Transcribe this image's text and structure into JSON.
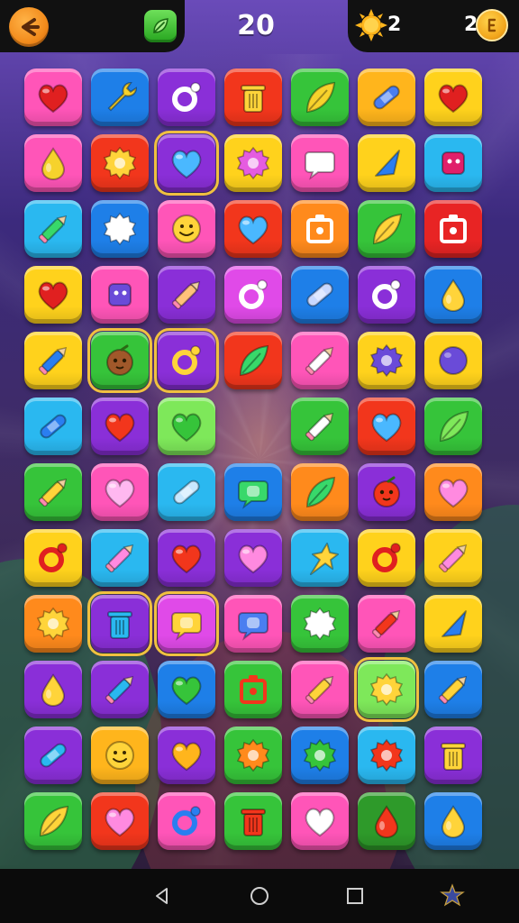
{
  "hud": {
    "moves": "20",
    "sun_count": "2",
    "coin_count": "2",
    "colors": {
      "gold": "#f2a61c",
      "booster": "#26a51f"
    }
  },
  "board": {
    "rows": 12,
    "cols": 7,
    "tiles": [
      [
        {
          "c": "#ff55b8",
          "i": "heart",
          "ic": "#e02020"
        },
        {
          "c": "#1e7fe8",
          "i": "wrench",
          "ic": "#f6d22c"
        },
        {
          "c": "#8a2fd8",
          "i": "ring",
          "ic": "#ffffff"
        },
        {
          "c": "#f2361c",
          "i": "trash",
          "ic": "#ffd43a"
        },
        {
          "c": "#36c43a",
          "i": "leaf",
          "ic": "#f6d22c"
        },
        {
          "c": "#ffb51c",
          "i": "bandage",
          "ic": "#4a7ef0"
        },
        {
          "c": "#ffd21c",
          "i": "heart",
          "ic": "#e02020"
        }
      ],
      [
        {
          "c": "#ff55b8",
          "i": "drop",
          "ic": "#f6d22c"
        },
        {
          "c": "#f2361c",
          "i": "gear",
          "ic": "#ffd43a"
        },
        {
          "c": "#8a2fd8",
          "i": "heart",
          "ic": "#4ab8ff",
          "sel": true
        },
        {
          "c": "#ffd21c",
          "i": "gear",
          "ic": "#e55ce0"
        },
        {
          "c": "#ff55b8",
          "i": "bubble",
          "ic": "#ffffff"
        },
        {
          "c": "#ffd21c",
          "i": "cone",
          "ic": "#2a7ef0"
        },
        {
          "c": "#2ab8f0",
          "i": "square",
          "ic": "#e0206a"
        }
      ],
      [
        {
          "c": "#2ab8f0",
          "i": "pencil",
          "ic": "#38d86a"
        },
        {
          "c": "#1e7fe8",
          "i": "gear",
          "ic": "#ffffff"
        },
        {
          "c": "#ff55b8",
          "i": "smile",
          "ic": "#ffd43a"
        },
        {
          "c": "#f2361c",
          "i": "heart",
          "ic": "#4ab8ff"
        },
        {
          "c": "#ff8a1c",
          "i": "box",
          "ic": "#ffffff"
        },
        {
          "c": "#36c43a",
          "i": "leaf",
          "ic": "#ffd43a"
        },
        {
          "c": "#e82424",
          "i": "box",
          "ic": "#ffffff"
        }
      ],
      [
        {
          "c": "#ffd21c",
          "i": "heart",
          "ic": "#e02020"
        },
        {
          "c": "#ff55b8",
          "i": "square",
          "ic": "#6a4bd8"
        },
        {
          "c": "#8a2fd8",
          "i": "pencil",
          "ic": "#ffc27a"
        },
        {
          "c": "#e04ae8",
          "i": "ring",
          "ic": "#ffffff"
        },
        {
          "c": "#1e7fe8",
          "i": "bandage",
          "ic": "#c8d8ff"
        },
        {
          "c": "#8a2fd8",
          "i": "ring",
          "ic": "#ffffff"
        },
        {
          "c": "#1e7fe8",
          "i": "drop",
          "ic": "#ffd43a"
        }
      ],
      [
        {
          "c": "#ffd21c",
          "i": "pencil",
          "ic": "#2a7ef0"
        },
        {
          "c": "#36c43a",
          "i": "face",
          "ic": "#a0582a",
          "sel": true
        },
        {
          "c": "#8a2fd8",
          "i": "ring",
          "ic": "#ffd43a",
          "sel": true
        },
        {
          "c": "#f2361c",
          "i": "leaf",
          "ic": "#38d86a"
        },
        {
          "c": "#ff55b8",
          "i": "pencil",
          "ic": "#ffffff"
        },
        {
          "c": "#ffd21c",
          "i": "gear",
          "ic": "#6a4bd8"
        },
        {
          "c": "#ffd21c",
          "i": "dot",
          "ic": "#6a4bd8"
        }
      ],
      [
        {
          "c": "#2ab8f0",
          "i": "bandage",
          "ic": "#2a7ef0"
        },
        {
          "c": "#8a2fd8",
          "i": "heart",
          "ic": "#f2361c"
        },
        {
          "c": "#7ee85a",
          "i": "heart",
          "ic": "#36c43a"
        },
        null,
        {
          "c": "#36c43a",
          "i": "pencil",
          "ic": "#ffffff"
        },
        {
          "c": "#f2361c",
          "i": "heart",
          "ic": "#4ab8ff"
        },
        {
          "c": "#36c43a",
          "i": "leaf",
          "ic": "#7ee85a"
        }
      ],
      [
        {
          "c": "#36c43a",
          "i": "pencil",
          "ic": "#ffd43a"
        },
        {
          "c": "#ff55b8",
          "i": "heart",
          "ic": "#ffb8f0"
        },
        {
          "c": "#2ab8f0",
          "i": "bandage",
          "ic": "#c8e8ff"
        },
        {
          "c": "#1e7fe8",
          "i": "bubble",
          "ic": "#38d86a"
        },
        {
          "c": "#ff8a1c",
          "i": "leaf",
          "ic": "#38d86a"
        },
        {
          "c": "#8a2fd8",
          "i": "face",
          "ic": "#f2361c"
        },
        {
          "c": "#ff8a1c",
          "i": "heart",
          "ic": "#ff8ae0"
        }
      ],
      [
        {
          "c": "#ffd21c",
          "i": "ring",
          "ic": "#e02020"
        },
        {
          "c": "#2ab8f0",
          "i": "pencil",
          "ic": "#ff8ae0"
        },
        {
          "c": "#8a2fd8",
          "i": "heart",
          "ic": "#f2361c"
        },
        {
          "c": "#8a2fd8",
          "i": "heart",
          "ic": "#ff8ae0"
        },
        {
          "c": "#2ab8f0",
          "i": "star",
          "ic": "#ffd43a"
        },
        {
          "c": "#ffd21c",
          "i": "ring",
          "ic": "#e02020"
        },
        {
          "c": "#ffd21c",
          "i": "pencil",
          "ic": "#ff8ae0"
        }
      ],
      [
        {
          "c": "#ff8a1c",
          "i": "gear",
          "ic": "#ffd43a"
        },
        {
          "c": "#8a2fd8",
          "i": "trash",
          "ic": "#2ab8f0",
          "sel": true
        },
        {
          "c": "#e04ae8",
          "i": "bubble",
          "ic": "#ffd43a",
          "sel": true
        },
        {
          "c": "#ff55b8",
          "i": "bubble",
          "ic": "#4a7ef0"
        },
        {
          "c": "#36c43a",
          "i": "gear",
          "ic": "#ffffff"
        },
        {
          "c": "#ff55b8",
          "i": "pencil",
          "ic": "#f2361c"
        },
        {
          "c": "#ffd21c",
          "i": "cone",
          "ic": "#2a7ef0"
        }
      ],
      [
        {
          "c": "#8a2fd8",
          "i": "drop",
          "ic": "#ffd43a"
        },
        {
          "c": "#8a2fd8",
          "i": "pencil",
          "ic": "#2ab8f0"
        },
        {
          "c": "#1e7fe8",
          "i": "heart",
          "ic": "#36c43a"
        },
        {
          "c": "#36c43a",
          "i": "box",
          "ic": "#f2361c"
        },
        {
          "c": "#ff55b8",
          "i": "pencil",
          "ic": "#ffd43a"
        },
        {
          "c": "#7ee85a",
          "i": "gear",
          "ic": "#ffd43a",
          "sel": true
        },
        {
          "c": "#1e7fe8",
          "i": "pencil",
          "ic": "#ffd43a"
        }
      ],
      [
        {
          "c": "#8a2fd8",
          "i": "bandage",
          "ic": "#2ab8f0"
        },
        {
          "c": "#ffb51c",
          "i": "smile",
          "ic": "#ffd43a"
        },
        {
          "c": "#8a2fd8",
          "i": "heart",
          "ic": "#ffb51c"
        },
        {
          "c": "#36c43a",
          "i": "gear",
          "ic": "#ff8a1c"
        },
        {
          "c": "#1e7fe8",
          "i": "gear",
          "ic": "#36c43a"
        },
        {
          "c": "#2ab8f0",
          "i": "gear",
          "ic": "#f2361c"
        },
        {
          "c": "#8a2fd8",
          "i": "trash",
          "ic": "#ffd43a"
        }
      ],
      [
        {
          "c": "#36c43a",
          "i": "leaf",
          "ic": "#ffd43a"
        },
        {
          "c": "#f2361c",
          "i": "heart",
          "ic": "#ff8ae0"
        },
        {
          "c": "#ff55b8",
          "i": "ring",
          "ic": "#2a7ef0"
        },
        {
          "c": "#36c43a",
          "i": "trash",
          "ic": "#f2361c"
        },
        {
          "c": "#ff55b8",
          "i": "heart",
          "ic": "#ffffff"
        },
        {
          "c": "#2e9a2a",
          "i": "drop",
          "ic": "#f2361c"
        },
        {
          "c": "#1e7fe8",
          "i": "drop",
          "ic": "#ffd43a"
        }
      ]
    ]
  }
}
